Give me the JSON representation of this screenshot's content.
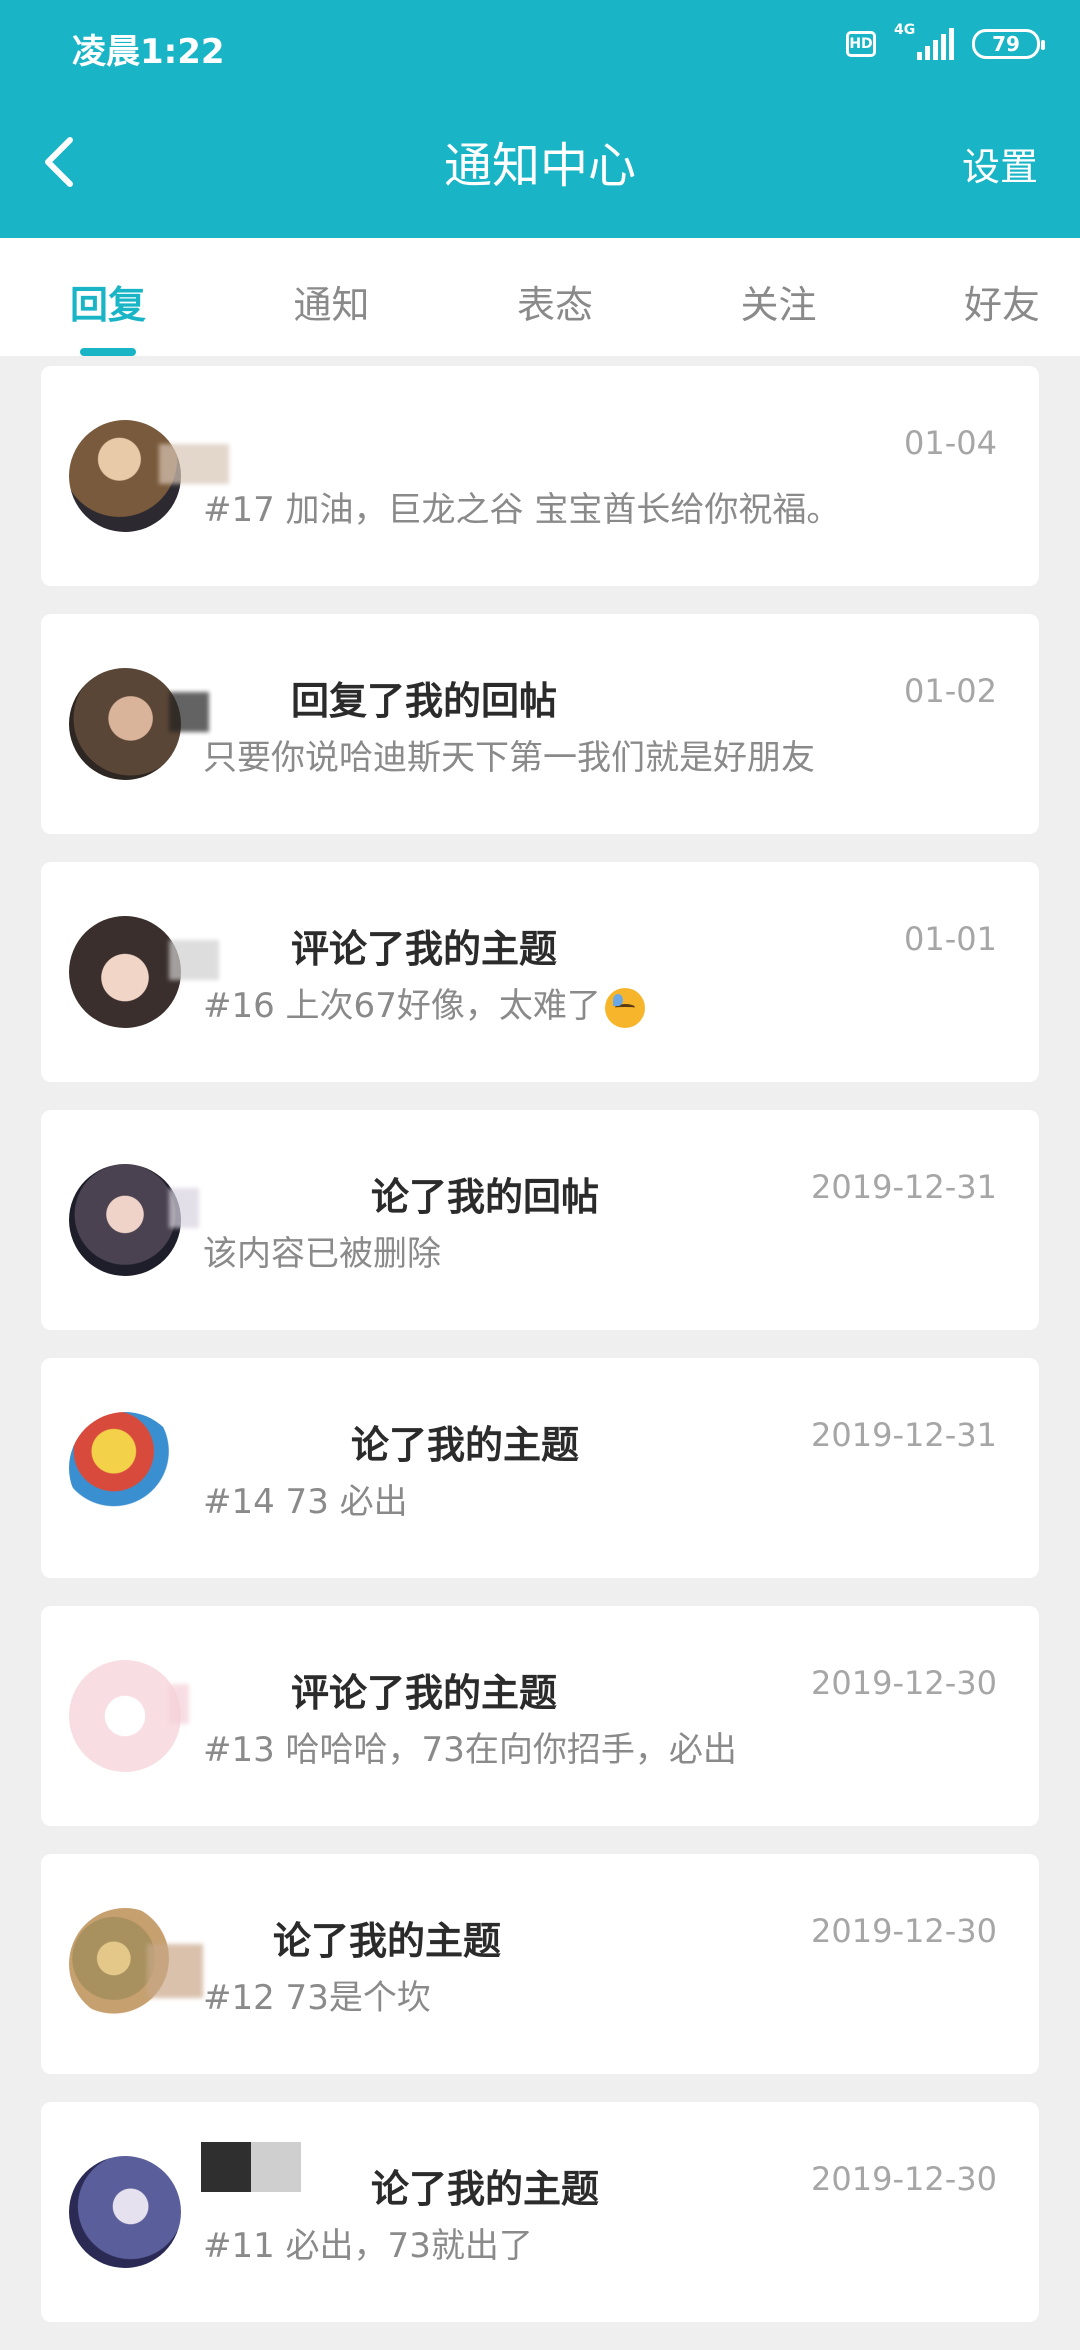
{
  "status_bar": {
    "time": "凌晨1:22",
    "hd": "HD",
    "network": "4G",
    "battery": "79"
  },
  "header": {
    "title": "通知中心",
    "settings": "设置"
  },
  "tabs": [
    {
      "label": "回复",
      "active": true
    },
    {
      "label": "通知",
      "active": false
    },
    {
      "label": "表态",
      "active": false
    },
    {
      "label": "关注",
      "active": false
    },
    {
      "label": "好友",
      "active": false
    }
  ],
  "notifications": [
    {
      "action": "",
      "date": "01-04",
      "content": "#17 加油，巨龙之谷 宝宝酋长给你祝福。",
      "avatar_color": "#7a5a3c"
    },
    {
      "action": "回复了我的回帖",
      "date": "01-02",
      "content": "只要你说哈迪斯天下第一我们就是好朋友",
      "avatar_color": "#5a4636"
    },
    {
      "action": "评论了我的主题",
      "date": "01-01",
      "content": "#16 上次67好像，太难了",
      "avatar_color": "#3a2f2c"
    },
    {
      "action": "论了我的回帖",
      "date": "2019-12-31",
      "content": "该内容已被删除",
      "avatar_color": "#4a4250"
    },
    {
      "action": "论了我的主题",
      "date": "2019-12-31",
      "content": "#14 73 必出",
      "avatar_color": "#e6b84a"
    },
    {
      "action": "评论了我的主题",
      "date": "2019-12-30",
      "content": "#13 哈哈哈，73在向你招手，必出",
      "avatar_color": "#f8dde3"
    },
    {
      "action": "论了我的主题",
      "date": "2019-12-30",
      "content": "#12 73是个坎",
      "avatar_color": "#a8915e"
    },
    {
      "action": "论了我的主题",
      "date": "2019-12-30",
      "content": "#11 必出，73就出了",
      "avatar_color": "#5a5e9a"
    }
  ]
}
